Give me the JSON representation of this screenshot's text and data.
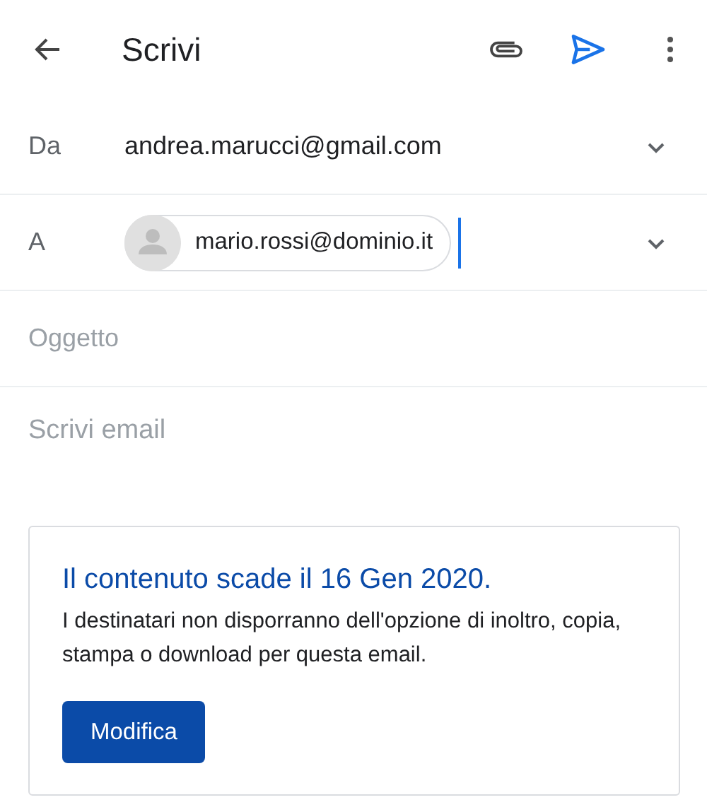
{
  "toolbar": {
    "title": "Scrivi"
  },
  "from": {
    "label": "Da",
    "value": "andrea.marucci@gmail.com"
  },
  "to": {
    "label": "A",
    "recipients": [
      "mario.rossi@dominio.it"
    ]
  },
  "subject": {
    "placeholder": "Oggetto"
  },
  "body": {
    "placeholder": "Scrivi email"
  },
  "notice": {
    "title": "Il contenuto scade il 16 Gen 2020.",
    "text": "I destinatari non disporranno dell'opzione di inoltro, copia, stampa o download per questa email.",
    "button": "Modifica"
  }
}
